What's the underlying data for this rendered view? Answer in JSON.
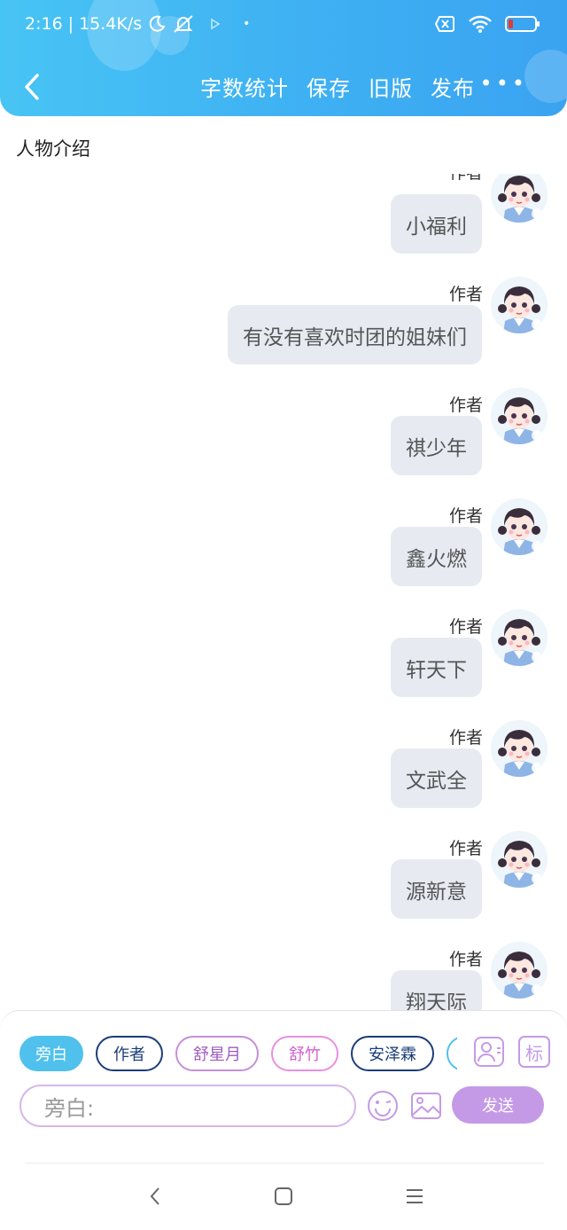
{
  "status_bar": {
    "time": "2:16",
    "network_speed": "15.4K/s",
    "icons": [
      "moon-icon",
      "mute-icon",
      "play-icon",
      "sim-off-icon",
      "wifi-icon",
      "battery-icon"
    ]
  },
  "header": {
    "back_icon": "chevron-left-icon",
    "actions": [
      "字数统计",
      "保存",
      "旧版",
      "发布"
    ],
    "more_label": "•••"
  },
  "section_title": "人物介绍",
  "messages": [
    {
      "author": "作者",
      "text": "小福利"
    },
    {
      "author": "作者",
      "text": "有没有喜欢时团的姐妹们"
    },
    {
      "author": "作者",
      "text": "祺少年"
    },
    {
      "author": "作者",
      "text": "鑫火燃"
    },
    {
      "author": "作者",
      "text": "轩天下"
    },
    {
      "author": "作者",
      "text": "文武全"
    },
    {
      "author": "作者",
      "text": "源新意"
    },
    {
      "author": "作者",
      "text": "翔天际"
    }
  ],
  "composer": {
    "roles": [
      "旁白",
      "作者",
      "舒星月",
      "舒竹",
      "安泽霖"
    ],
    "selected_role": "旁白",
    "placeholder": "旁白:",
    "mark_label": "标",
    "send_label": "发送"
  },
  "colors": {
    "header": "#3fb2f3",
    "bubble": "#e7ebf1",
    "send": "#c49ae6",
    "selected_chip": "#4fc1ec"
  }
}
